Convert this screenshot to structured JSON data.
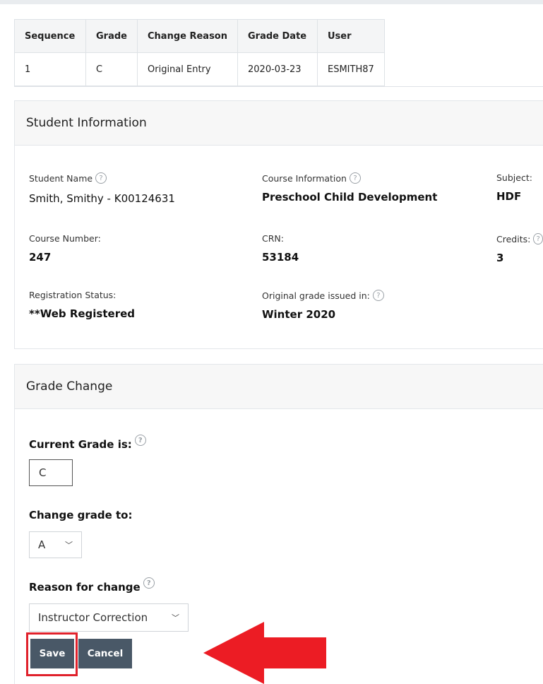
{
  "history_table": {
    "headers": [
      "Sequence",
      "Grade",
      "Change Reason",
      "Grade Date",
      "User"
    ],
    "rows": [
      [
        "1",
        "C",
        "Original Entry",
        "2020-03-23",
        "ESMITH87"
      ]
    ]
  },
  "student_info": {
    "title": "Student Information",
    "student_name_label": "Student Name",
    "student_name_value": "Smith, Smithy  - K00124631",
    "course_info_label": "Course Information",
    "course_info_value": "Preschool Child Development",
    "subject_label": "Subject:",
    "subject_value": "HDF",
    "course_number_label": "Course Number:",
    "course_number_value": "247",
    "crn_label": "CRN:",
    "crn_value": "53184",
    "credits_label": "Credits:",
    "credits_value": "3",
    "reg_status_label": "Registration Status:",
    "reg_status_value": "**Web Registered",
    "orig_grade_label": "Original grade issued in:",
    "orig_grade_value": "Winter 2020",
    "help_glyph": "?"
  },
  "grade_change": {
    "title": "Grade Change",
    "current_label": "Current Grade is:",
    "current_value": "C",
    "change_to_label": "Change grade to:",
    "change_to_value": "A",
    "reason_label": "Reason for change",
    "reason_value": "Instructor Correction",
    "save_label": "Save",
    "cancel_label": "Cancel"
  },
  "colors": {
    "button": "#495867",
    "highlight": "#e0212b",
    "arrow": "#ec1c24"
  }
}
